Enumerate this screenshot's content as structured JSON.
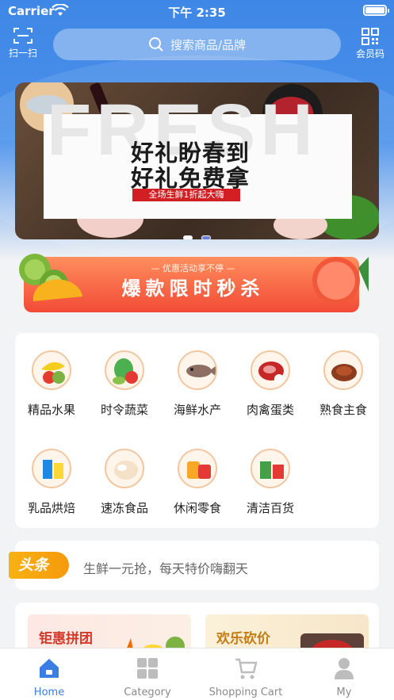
{
  "status_bar": {
    "carrier": "Carrier",
    "time": "下午 2:35"
  },
  "header": {
    "scan_label": "扫一扫",
    "search_placeholder": "搜索商品/品牌",
    "member_label": "会员码"
  },
  "banner": {
    "watermark": "FRESH",
    "line1": "好礼盼春到",
    "line2": "好礼免费拿",
    "tag": "全场生鲜1折起大嗨",
    "active_dot": 2
  },
  "flash_sale": {
    "subtitle": "— 优惠活动享不停 —",
    "title": "爆款限时秒杀"
  },
  "categories": [
    {
      "label": "精品水果",
      "icon": "fruit-icon"
    },
    {
      "label": "时令蔬菜",
      "icon": "vegetable-icon"
    },
    {
      "label": "海鲜水产",
      "icon": "seafood-icon"
    },
    {
      "label": "肉禽蛋类",
      "icon": "meat-icon"
    },
    {
      "label": "熟食主食",
      "icon": "cooked-food-icon"
    },
    {
      "label": "乳品烘焙",
      "icon": "dairy-icon"
    },
    {
      "label": "速冻食品",
      "icon": "frozen-food-icon"
    },
    {
      "label": "休闲零食",
      "icon": "snack-icon"
    },
    {
      "label": "清洁百货",
      "icon": "cleaning-icon"
    }
  ],
  "news": {
    "badge": "头条",
    "text": "生鲜一元抢，每天特价嗨翻天"
  },
  "promos": {
    "left_title": "钜惠拼团",
    "right_title": "欢乐砍价"
  },
  "tab_bar": {
    "tabs": [
      {
        "label": "Home",
        "icon": "home-icon",
        "active": true
      },
      {
        "label": "Category",
        "icon": "category-icon",
        "active": false
      },
      {
        "label": "Shopping Cart",
        "icon": "cart-icon",
        "active": false
      },
      {
        "label": "My",
        "icon": "user-icon",
        "active": false
      }
    ]
  },
  "colors": {
    "primary": "#3f87e6",
    "flash": "#f24b36",
    "news_badge": "#f7b112",
    "tab_active": "#3a7ee3"
  }
}
